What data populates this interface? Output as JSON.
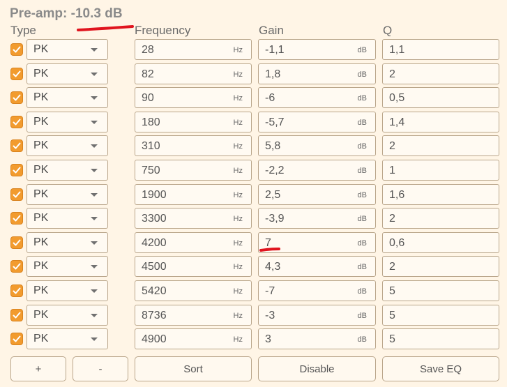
{
  "preamp": {
    "label": "Pre-amp: -10.3 dB"
  },
  "headers": {
    "type": "Type",
    "frequency": "Frequency",
    "gain": "Gain",
    "q": "Q"
  },
  "units": {
    "frequency": "Hz",
    "gain": "dB"
  },
  "filters": [
    {
      "enabled": true,
      "type": "PK",
      "frequency": "28",
      "gain": "-1,1",
      "q": "1,1"
    },
    {
      "enabled": true,
      "type": "PK",
      "frequency": "82",
      "gain": "1,8",
      "q": "2"
    },
    {
      "enabled": true,
      "type": "PK",
      "frequency": "90",
      "gain": "-6",
      "q": "0,5"
    },
    {
      "enabled": true,
      "type": "PK",
      "frequency": "180",
      "gain": "-5,7",
      "q": "1,4"
    },
    {
      "enabled": true,
      "type": "PK",
      "frequency": "310",
      "gain": "5,8",
      "q": "2"
    },
    {
      "enabled": true,
      "type": "PK",
      "frequency": "750",
      "gain": "-2,2",
      "q": "1"
    },
    {
      "enabled": true,
      "type": "PK",
      "frequency": "1900",
      "gain": "2,5",
      "q": "1,6"
    },
    {
      "enabled": true,
      "type": "PK",
      "frequency": "3300",
      "gain": "-3,9",
      "q": "2"
    },
    {
      "enabled": true,
      "type": "PK",
      "frequency": "4200",
      "gain": "7",
      "q": "0,6"
    },
    {
      "enabled": true,
      "type": "PK",
      "frequency": "4500",
      "gain": "4,3",
      "q": "2"
    },
    {
      "enabled": true,
      "type": "PK",
      "frequency": "5420",
      "gain": "-7",
      "q": "5"
    },
    {
      "enabled": true,
      "type": "PK",
      "frequency": "8736",
      "gain": "-3",
      "q": "5"
    },
    {
      "enabled": true,
      "type": "PK",
      "frequency": "4900",
      "gain": "3",
      "q": "5"
    }
  ],
  "buttons": {
    "add": "+",
    "remove": "-",
    "sort": "Sort",
    "disable": "Disable",
    "save": "Save EQ"
  },
  "colors": {
    "accent": "#f29b2e",
    "annotation": "#e0141e",
    "background": "#fff5e6"
  }
}
